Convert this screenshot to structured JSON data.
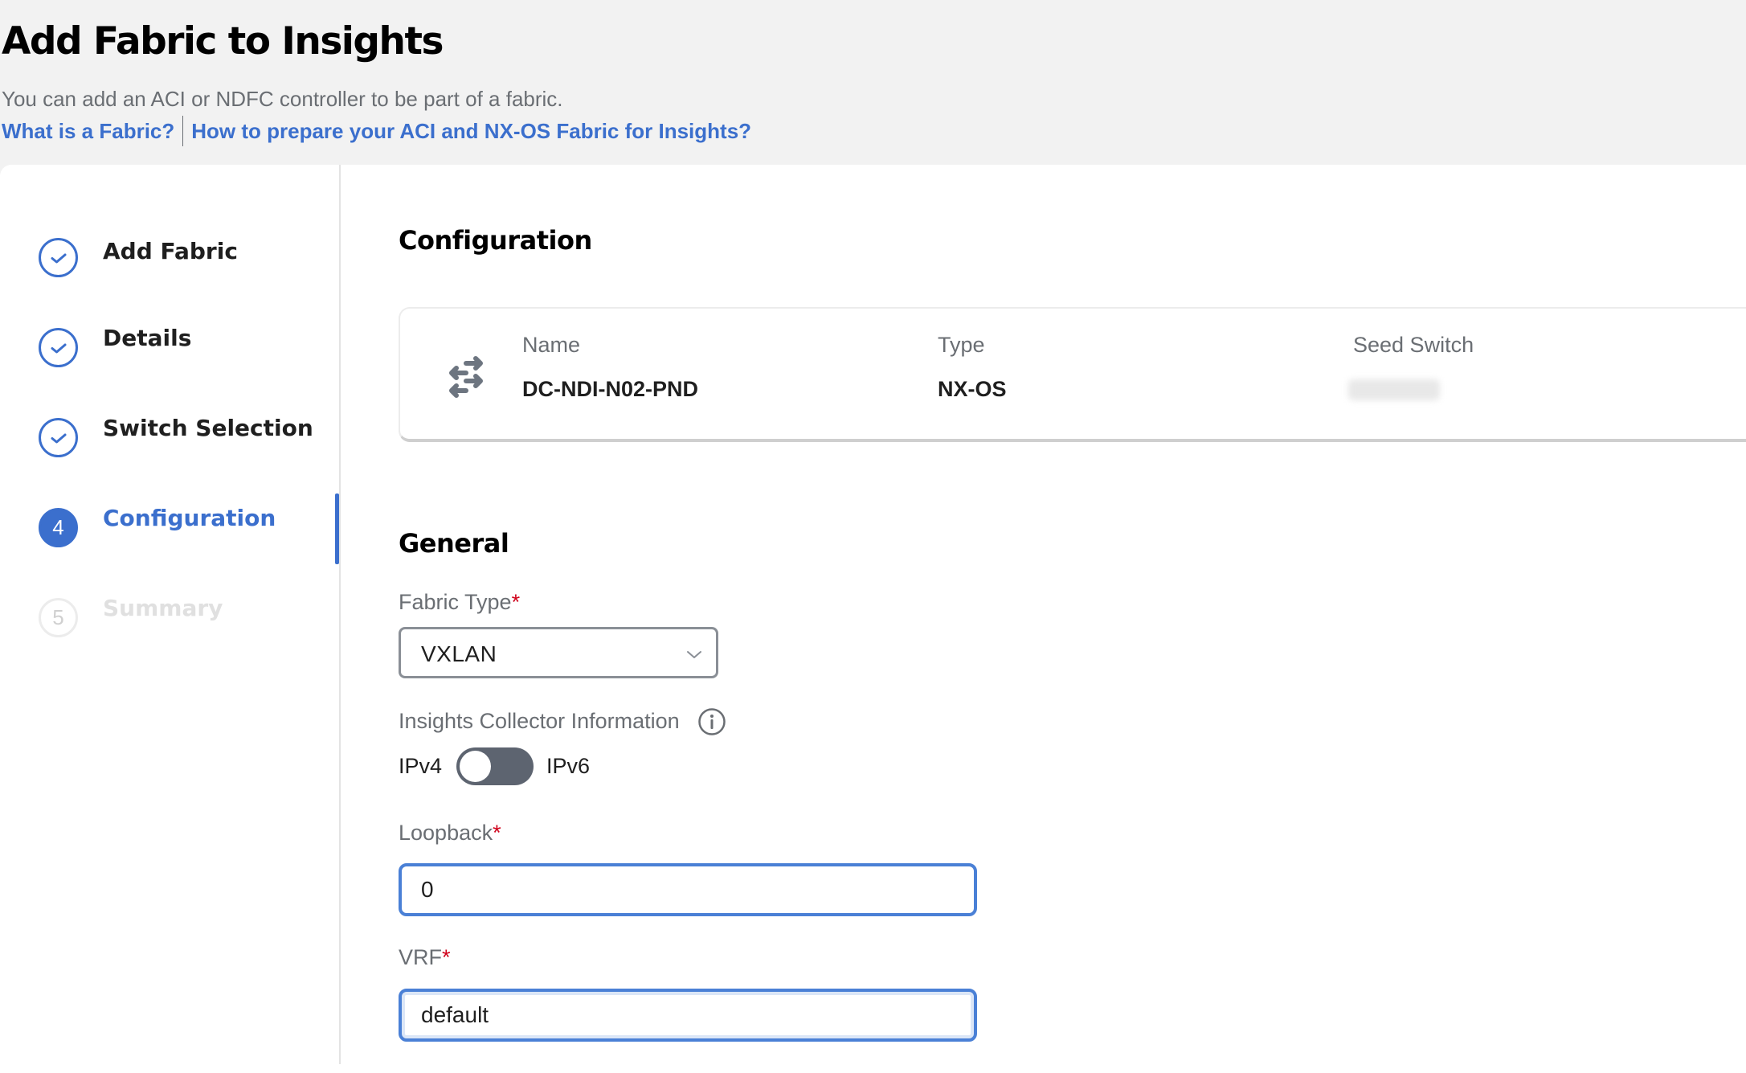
{
  "header": {
    "title": "Add Fabric to Insights",
    "subtitle": "You can add an ACI or NDFC controller to be part of a fabric.",
    "links": [
      {
        "label": "What is a Fabric?"
      },
      {
        "label": "How to prepare your ACI and NX-OS Fabric for Insights?"
      }
    ]
  },
  "steps": [
    {
      "number": "1",
      "label": "Add Fabric",
      "status": "complete"
    },
    {
      "number": "2",
      "label": "Details",
      "status": "complete"
    },
    {
      "number": "3",
      "label": "Switch Selection",
      "status": "complete"
    },
    {
      "number": "4",
      "label": "Configuration",
      "status": "active"
    },
    {
      "number": "5",
      "label": "Summary",
      "status": "pending"
    }
  ],
  "configuration": {
    "heading": "Configuration",
    "card": {
      "icon": "switch-arrows-icon",
      "columns": [
        {
          "label": "Name",
          "value": "DC-NDI-N02-PND"
        },
        {
          "label": "Type",
          "value": "NX-OS"
        },
        {
          "label": "Seed Switch",
          "value": ""
        }
      ]
    }
  },
  "general": {
    "heading": "General",
    "fabric_type": {
      "label": "Fabric Type",
      "required": "*",
      "value": "VXLAN"
    },
    "collector": {
      "label": "Insights Collector Information",
      "toggle_left": "IPv4",
      "toggle_right": "IPv6",
      "toggle_state": "IPv4"
    },
    "loopback": {
      "label": "Loopback",
      "required": "*",
      "value": "0"
    },
    "vrf": {
      "label": "VRF",
      "required": "*",
      "value": "default"
    }
  },
  "colors": {
    "accent": "#3b6fcd",
    "required": "#d0021b",
    "toggle_track": "#5d6470"
  }
}
